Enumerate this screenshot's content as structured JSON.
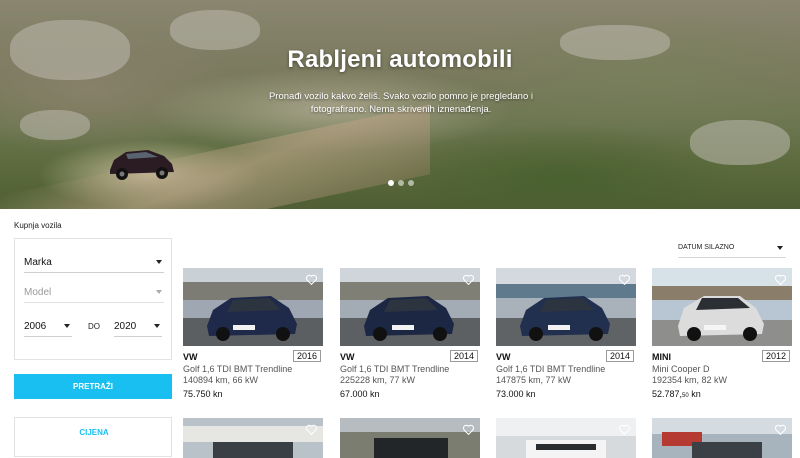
{
  "hero": {
    "title": "Rabljeni automobili",
    "subtitle": "Pronađi vozilo kakvo želiš. Svako vozilo pomno je pregledano i fotografirano. Nema skrivenih iznenađenja.",
    "slides": 3,
    "active_slide": 1
  },
  "filters": {
    "section_label": "Kupnja vozila",
    "make": "Marka",
    "model": "Model",
    "year_from": "2006",
    "year_separator": "DO",
    "year_to": "2020",
    "search_label": "PRETRAŽI",
    "price_label": "CIJENA"
  },
  "sort": {
    "value": "DATUM SILAZNO"
  },
  "listings": [
    {
      "make": "VW",
      "year": "2016",
      "model": "Golf 1,6 TDI BMT Trendline",
      "details": "140894 km, 66 kW",
      "price": "75.750 kn",
      "color": "#1f2a4a"
    },
    {
      "make": "VW",
      "year": "2014",
      "model": "Golf 1,6 TDI BMT Trendline",
      "details": "225228 km, 77 kW",
      "price": "67.000 kn",
      "color": "#1c2744"
    },
    {
      "make": "VW",
      "year": "2014",
      "model": "Golf 1,6 TDI BMT Trendline",
      "details": "147875 km, 77 kW",
      "price": "73.000 kn",
      "color": "#22304f"
    },
    {
      "make": "MINI",
      "year": "2012",
      "model": "Mini Cooper D",
      "details": "192354 km, 82 kW",
      "price_main": "52.787,",
      "price_cents": "50",
      "price_currency": "kn",
      "color": "#dcdcdc"
    }
  ],
  "colors": {
    "accent": "#18bff0"
  }
}
